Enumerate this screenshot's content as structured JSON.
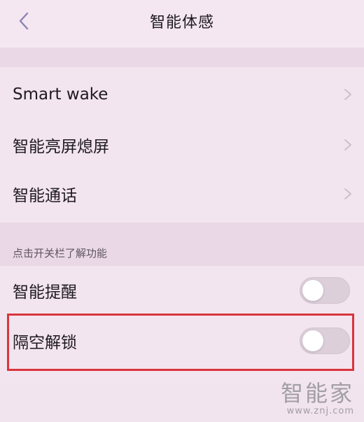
{
  "header": {
    "title": "智能体感"
  },
  "settings_list": [
    {
      "label": "Smart wake"
    },
    {
      "label": "智能亮屏熄屏"
    },
    {
      "label": "智能通话"
    }
  ],
  "section": {
    "hint": "点击开关栏了解功能",
    "toggles": [
      {
        "label": "智能提醒",
        "on": false
      },
      {
        "label": "隔空解锁",
        "on": false
      }
    ]
  },
  "watermark": {
    "brand": "智能家",
    "url": "www.znj.com"
  },
  "colors": {
    "highlight_border": "#d9353d",
    "background": "#f1e4ef"
  }
}
